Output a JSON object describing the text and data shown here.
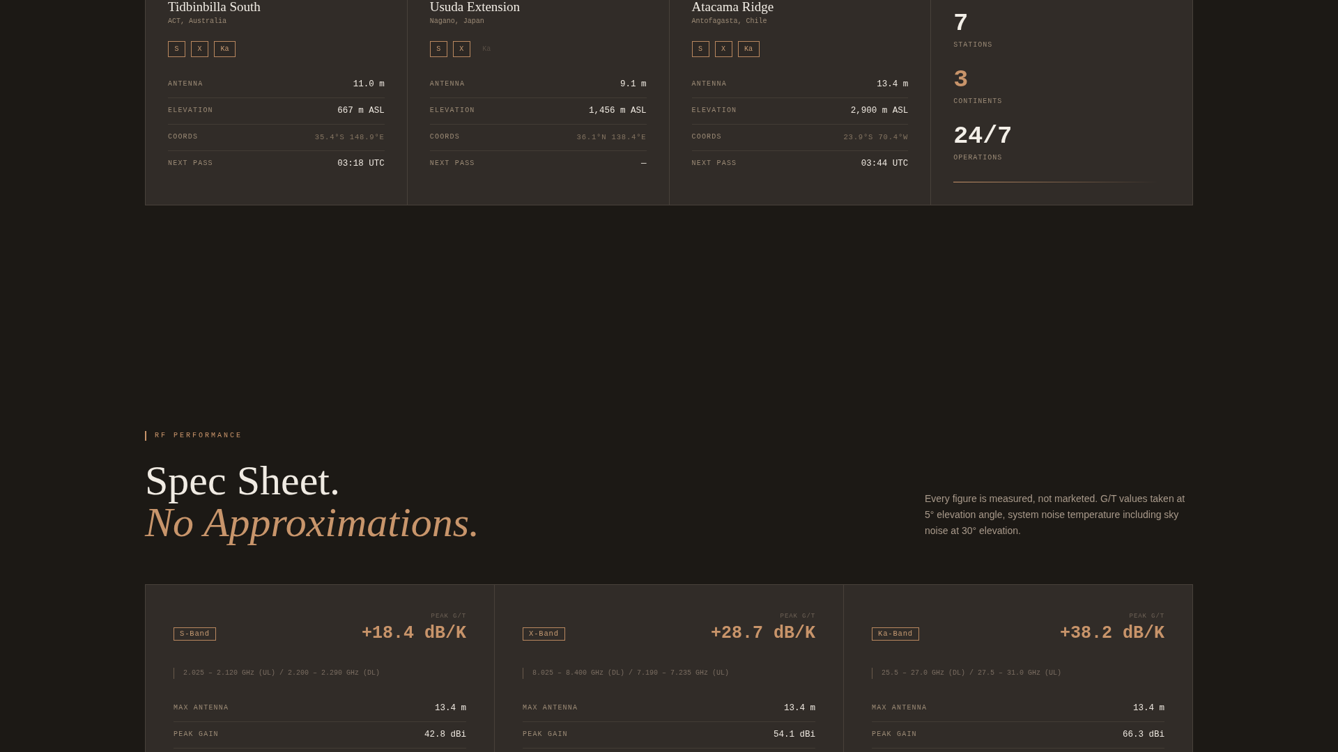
{
  "stations": [
    {
      "name": "Tidbinbilla South",
      "location": "ACT, Australia",
      "bands": [
        {
          "label": "S",
          "active": true
        },
        {
          "label": "X",
          "active": true
        },
        {
          "label": "Ka",
          "active": true
        }
      ],
      "specs": [
        {
          "kind": "reading",
          "label": "ANTENNA",
          "value": "11.0 m"
        },
        {
          "kind": "reading",
          "label": "ELEVATION",
          "value": "667 m ASL"
        },
        {
          "kind": "coords",
          "label": "COORDS",
          "value": "35.4°S 148.9°E"
        },
        {
          "kind": "reading",
          "label": "NEXT PASS",
          "value": "03:18 UTC"
        }
      ]
    },
    {
      "name": "Usuda Extension",
      "location": "Nagano, Japan",
      "bands": [
        {
          "label": "S",
          "active": true
        },
        {
          "label": "X",
          "active": true
        },
        {
          "label": "Ka",
          "active": false
        }
      ],
      "specs": [
        {
          "kind": "reading",
          "label": "ANTENNA",
          "value": "9.1 m"
        },
        {
          "kind": "reading",
          "label": "ELEVATION",
          "value": "1,456 m ASL"
        },
        {
          "kind": "coords",
          "label": "COORDS",
          "value": "36.1°N 138.4°E"
        },
        {
          "kind": "reading",
          "label": "NEXT PASS",
          "value": "—"
        }
      ]
    },
    {
      "name": "Atacama Ridge",
      "location": "Antofagasta, Chile",
      "bands": [
        {
          "label": "S",
          "active": true
        },
        {
          "label": "X",
          "active": true
        },
        {
          "label": "Ka",
          "active": true
        }
      ],
      "specs": [
        {
          "kind": "reading",
          "label": "ANTENNA",
          "value": "13.4 m"
        },
        {
          "kind": "reading",
          "label": "ELEVATION",
          "value": "2,900 m ASL"
        },
        {
          "kind": "coords",
          "label": "COORDS",
          "value": "23.9°S 70.4°W"
        },
        {
          "kind": "reading",
          "label": "NEXT PASS",
          "value": "03:44 UTC"
        }
      ]
    }
  ],
  "summary": {
    "stats": [
      {
        "value": "7",
        "label": "STATIONS",
        "accent": false
      },
      {
        "value": "3",
        "label": "CONTINENTS",
        "accent": true
      },
      {
        "value": "24/7",
        "label": "OPERATIONS",
        "accent": false
      }
    ]
  },
  "rf_performance": {
    "eyebrow": "RF PERFORMANCE",
    "title": "Spec Sheet.",
    "subtitle": "No Approximations.",
    "description": "Every figure is measured, not marketed. G/T values taken at 5° elevation angle, system noise temperature including sky noise at 30° elevation.",
    "bands": [
      {
        "badge": "S-Band",
        "metric_label": "PEAK G/T",
        "metric_value": "+18.4 dB/K",
        "frequencies": "2.025 – 2.120 GHz (UL) / 2.200 – 2.290 GHz (DL)",
        "specs": [
          {
            "label": "MAX ANTENNA",
            "value": "13.4 m"
          },
          {
            "label": "PEAK GAIN",
            "value": "42.8 dBi"
          }
        ]
      },
      {
        "badge": "X-Band",
        "metric_label": "PEAK G/T",
        "metric_value": "+28.7 dB/K",
        "frequencies": "8.025 – 8.400 GHz (DL) / 7.190 – 7.235 GHz (UL)",
        "specs": [
          {
            "label": "MAX ANTENNA",
            "value": "13.4 m"
          },
          {
            "label": "PEAK GAIN",
            "value": "54.1 dBi"
          }
        ]
      },
      {
        "badge": "Ka-Band",
        "metric_label": "PEAK G/T",
        "metric_value": "+38.2 dB/K",
        "frequencies": "25.5 – 27.0 GHz (DL) / 27.5 – 31.0 GHz (UL)",
        "specs": [
          {
            "label": "MAX ANTENNA",
            "value": "13.4 m"
          },
          {
            "label": "PEAK GAIN",
            "value": "66.3 dBi"
          }
        ]
      }
    ]
  }
}
